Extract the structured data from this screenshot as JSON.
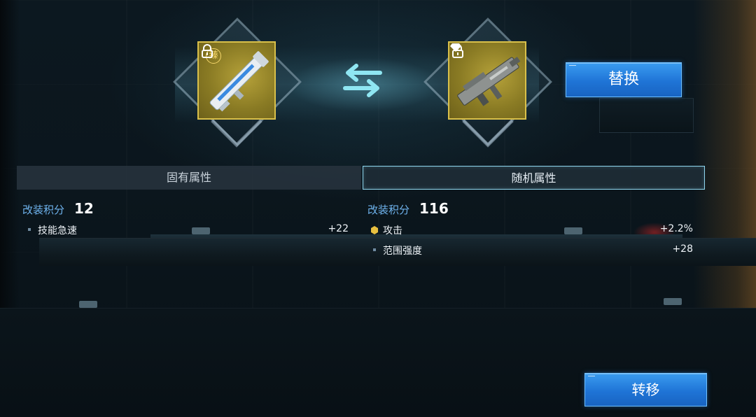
{
  "compare": {
    "left_item": {
      "badge": "臻",
      "frame_color": "#d9c04a"
    },
    "right_item": {
      "frame_color": "#d9c04a"
    }
  },
  "buttons": {
    "replace": "替换",
    "transfer": "转移"
  },
  "tabs": [
    {
      "label": "固有属性",
      "active": false
    },
    {
      "label": "随机属性",
      "active": true
    }
  ],
  "left_panel": {
    "score_label": "改装积分",
    "score_value": "12",
    "attributes": [
      {
        "name": "技能急速",
        "value": "+22"
      }
    ]
  },
  "right_panel": {
    "score_label": "改装积分",
    "score_value": "116",
    "attributes": [
      {
        "name": "攻击",
        "value": "+2.2%",
        "icon": "gold-hexagon-icon"
      },
      {
        "name": "范围强度",
        "value": "+28",
        "icon": "bullet-dot"
      }
    ]
  },
  "colors": {
    "accent_blue": "#1f74d6",
    "score_label": "#6fb4ee",
    "gold": "#e8c040"
  }
}
